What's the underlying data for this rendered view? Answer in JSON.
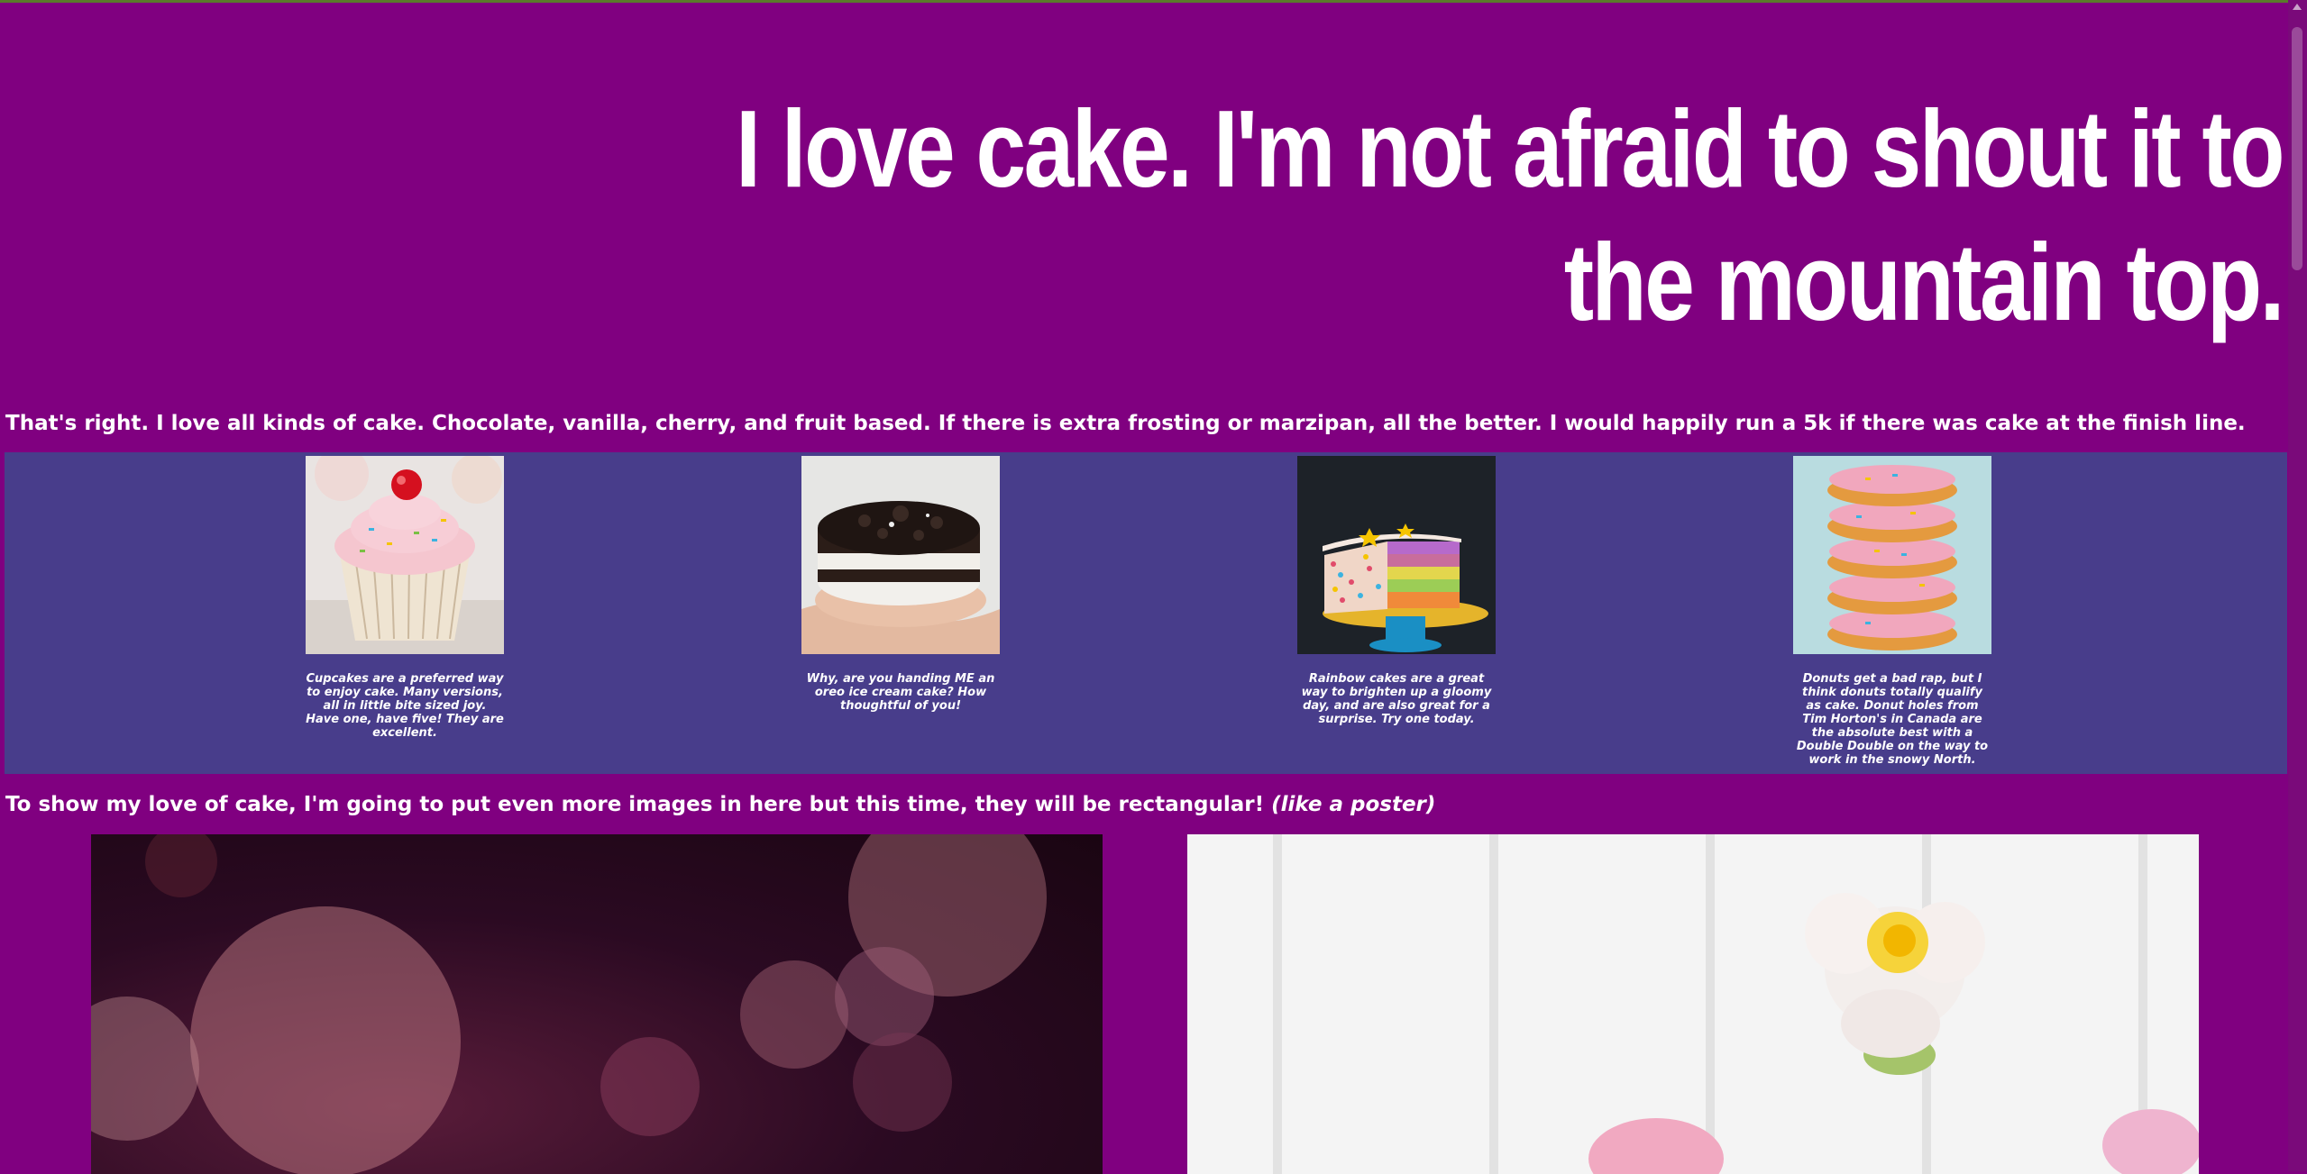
{
  "header": {
    "title": "I love cake. I'm not afraid to shout it to the mountain top."
  },
  "intro_text": "That's right. I love all kinds of cake. Chocolate, vanilla, cherry, and fruit based. If there is extra frosting or marzipan, all the better. I would happily run a 5k if there was cake at the finish line.",
  "gallery": {
    "items": [
      {
        "icon": "cupcake-image",
        "caption": "Cupcakes are a preferred way to enjoy cake. Many versions, all in little bite sized joy. Have one, have five! They are excellent."
      },
      {
        "icon": "oreo-cake-image",
        "caption": "Why, are you handing ME an oreo ice cream cake? How thoughtful of you!"
      },
      {
        "icon": "rainbow-cake-image",
        "caption": "Rainbow cakes are a great way to brighten up a gloomy day, and are also great for a surprise. Try one today."
      },
      {
        "icon": "donuts-image",
        "caption": "Donuts get a bad rap, but I think donuts totally qualify as cake. Donut holes from Tim Horton's in Canada are the absolute best with a Double Double on the way to work in the snowy North."
      }
    ]
  },
  "outro": {
    "text": "To show my love of cake, I'm going to put even more images in here but this time, they will be rectangular!",
    "emphasis": "(like a poster)"
  },
  "posters": [
    {
      "icon": "bokeh-lights-image"
    },
    {
      "icon": "flower-cupcakes-image"
    }
  ],
  "colors": {
    "page_background": "#800080",
    "gallery_background": "#483d8b",
    "text": "#ffffff"
  }
}
